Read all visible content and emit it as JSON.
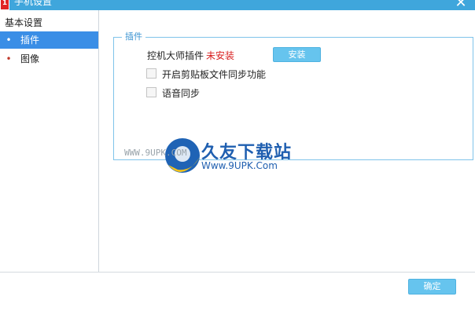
{
  "window": {
    "title": "手机设置",
    "app_icon_text": "1",
    "close_symbol": "✕"
  },
  "sidebar": {
    "header": "基本设置",
    "items": [
      {
        "label": "插件",
        "bullet": "•",
        "active": true
      },
      {
        "label": "图像",
        "bullet": "•",
        "active": false
      }
    ]
  },
  "plugin_group": {
    "legend": "插件",
    "plugin_name": "控机大师插件",
    "plugin_status": "未安装",
    "install_button": "安装",
    "options": [
      {
        "label": "开启剪贴板文件同步功能",
        "checked": false
      },
      {
        "label": "语音同步",
        "checked": false
      }
    ]
  },
  "watermark": {
    "left_text": "WWW.9UPK.COM",
    "brand": "久友下载站",
    "url": "Www.9UPK.Com"
  },
  "footer": {
    "ok_button": "确定"
  },
  "colors": {
    "titlebar": "#3fa6dc",
    "active_nav": "#3a8ee6",
    "button": "#66c4ee",
    "status_red": "#d81e1e",
    "group_border": "#7fc3ea"
  }
}
